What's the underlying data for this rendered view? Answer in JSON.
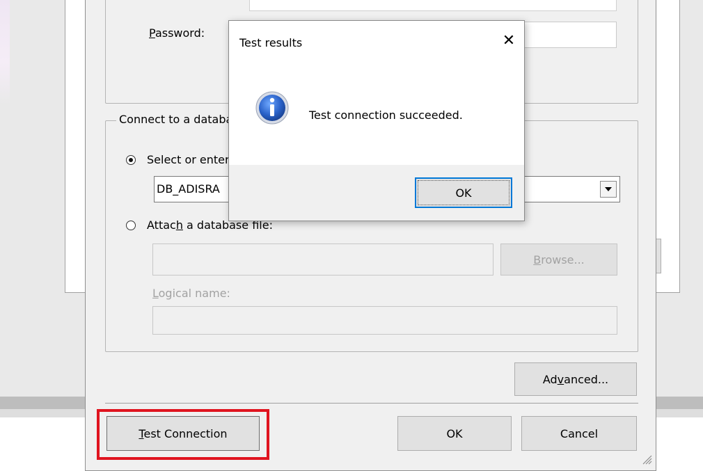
{
  "dialog": {
    "password_label": "Password:",
    "connect_group_label": "Connect to a database",
    "select_radio_label": "Select or enter a database name:",
    "database_value": "DB_ADISRA",
    "attach_radio_label": "Attach a database file:",
    "browse_button": "Browse...",
    "logical_name_label": "Logical name:",
    "advanced_button": "Advanced...",
    "test_connection_button": "Test Connection",
    "ok_button": "OK",
    "cancel_button": "Cancel"
  },
  "popup": {
    "title": "Test results",
    "message": "Test connection succeeded.",
    "ok_button": "OK",
    "close_glyph": "✕"
  },
  "colors": {
    "highlight": "#e0141f",
    "info_icon": "#2a62c9",
    "focus_border": "#0078d7"
  }
}
